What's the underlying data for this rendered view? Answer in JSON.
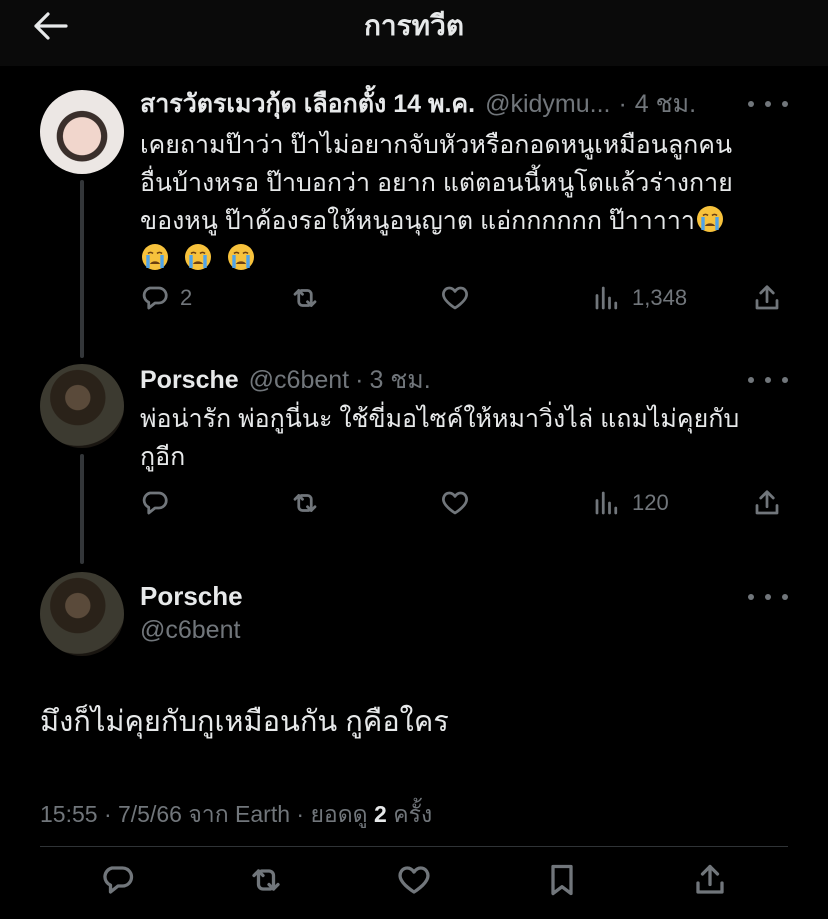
{
  "header": {
    "title": "การทวีต"
  },
  "tweets": [
    {
      "name": "สารวัตรเมวกุ้ด เลือกตั้ง 14 พ.ค.",
      "handle": "@kidymu...",
      "separator": "·",
      "time": "4 ชม.",
      "text_line1": "เคยถามป๊าว่า ป๊าไม่อยากจับหัวหรือกอดหนูเหมือนลูกคน",
      "text_line2": "อื่นบ้างหรอ ป๊าบอกว่า อยาก แต่ตอนนี้หนูโตแล้วร่างกาย",
      "text_line3": "ของหนู ป๊าค้องรอให้หนูอนุญาต แอ่กกกกกก ป๊าาาาา",
      "emoji": "loudly-crying-face",
      "reply_count": "2",
      "retweet_count": "",
      "like_count": "",
      "view_count": "1,348"
    },
    {
      "name": "Porsche",
      "handle": "@c6bent",
      "separator": "·",
      "time": "3 ชม.",
      "text_line1": "พ่อน่ารัก พ่อกูนี่นะ ใช้ขี่มอไซค์ให้หมาวิ่งไล่ แถมไม่คุยกับ",
      "text_line2": "กูอีก",
      "reply_count": "",
      "retweet_count": "",
      "like_count": "",
      "view_count": "120"
    }
  ],
  "main_tweet": {
    "name": "Porsche",
    "handle": "@c6bent",
    "text": "มึงก็ไม่คุยกับกูเหมือนกัน กูคือใคร",
    "meta_prefix": "15:55 · 7/5/66 จาก Earth · ยอดดู",
    "view_count": "2",
    "meta_suffix": "ครั้ง"
  },
  "icons": {
    "back": "arrow-left-icon",
    "more": "more-dots-icon",
    "reply": "reply-icon",
    "retweet": "retweet-icon",
    "like": "heart-icon",
    "views": "views-icon",
    "share": "share-icon",
    "bookmark": "bookmark-icon"
  },
  "colors": {
    "background": "#000000",
    "text": "#e7e9ea",
    "secondary": "#71767b",
    "divider": "#2f3336"
  }
}
